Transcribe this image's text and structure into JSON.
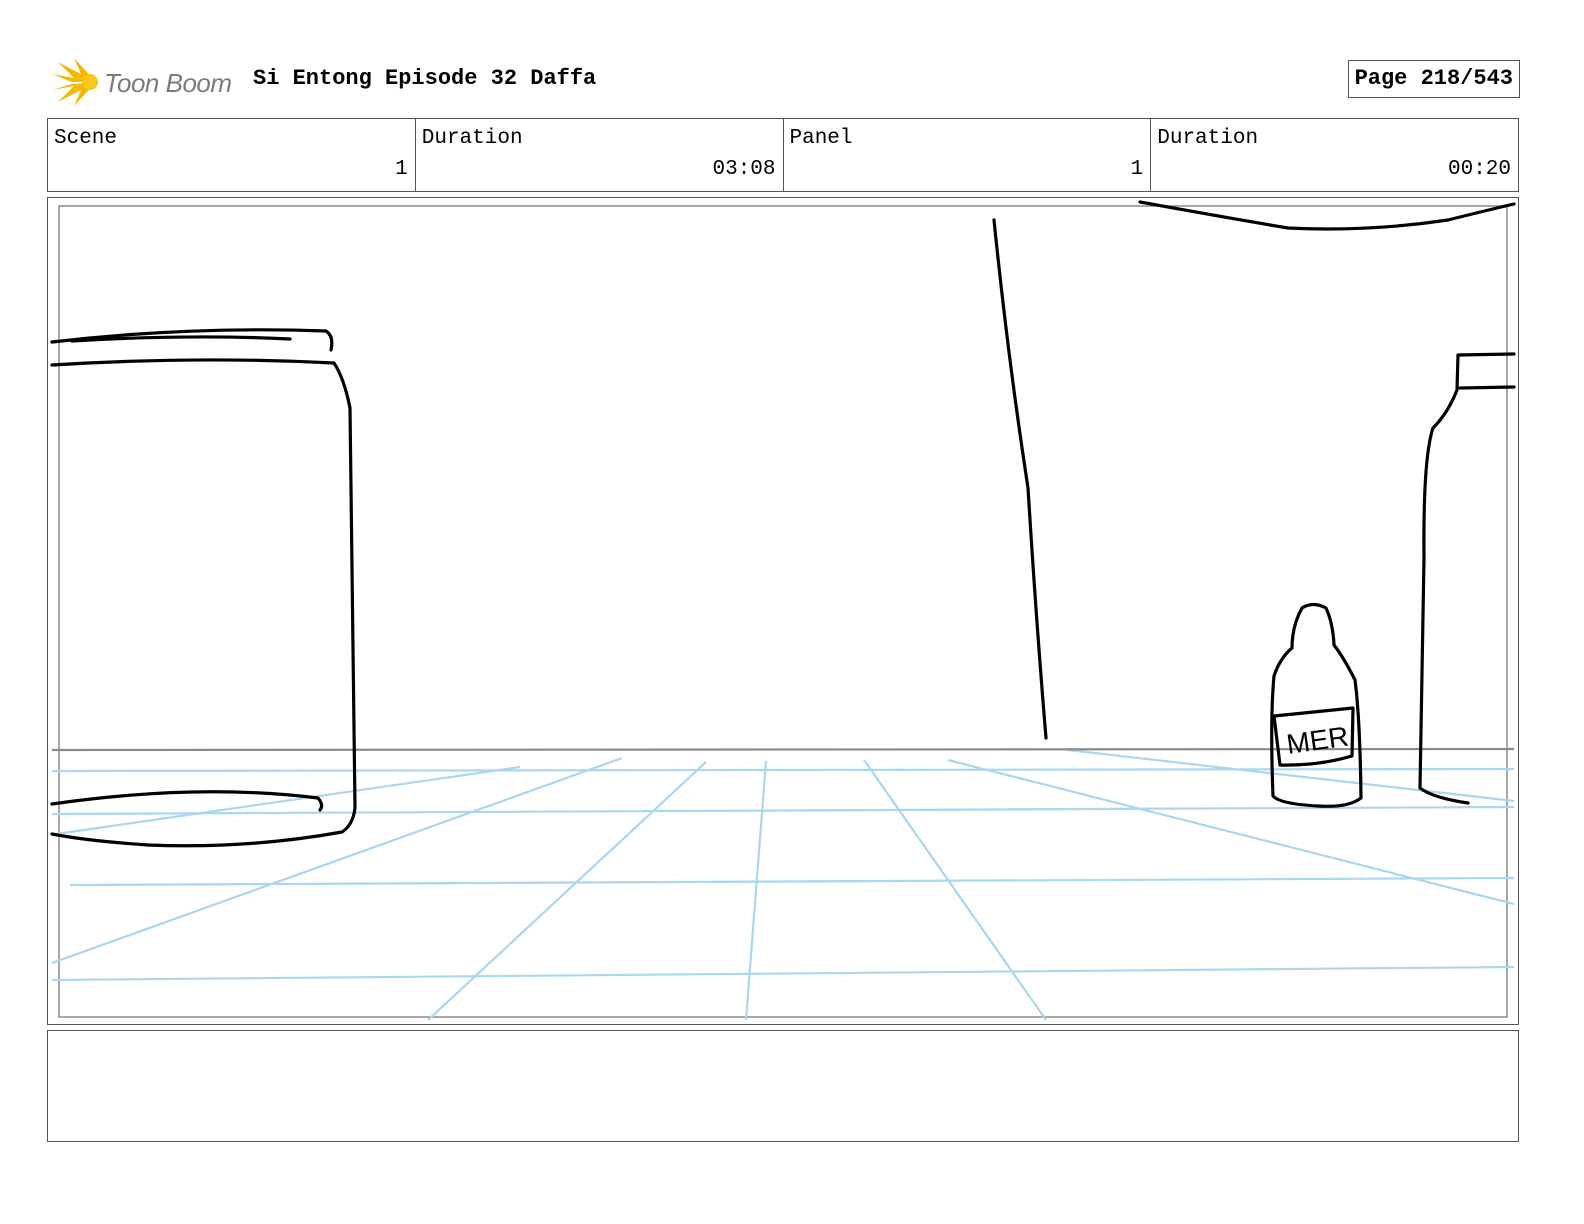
{
  "header": {
    "logo_text": "Toon Boom",
    "title": "Si Entong Episode 32 Daffa",
    "page": "Page 218/543"
  },
  "info": {
    "scene_label": "Scene",
    "scene_value": "1",
    "scene_duration_label": "Duration",
    "scene_duration_value": "03:08",
    "panel_label": "Panel",
    "panel_value": "1",
    "panel_duration_label": "Duration",
    "panel_duration_value": "00:20"
  },
  "panel": {
    "bottle_label": "MER"
  },
  "colors": {
    "sketch": "#000000",
    "guide_lines": "#a9d6f0",
    "horizon": "#8a8a8a"
  }
}
